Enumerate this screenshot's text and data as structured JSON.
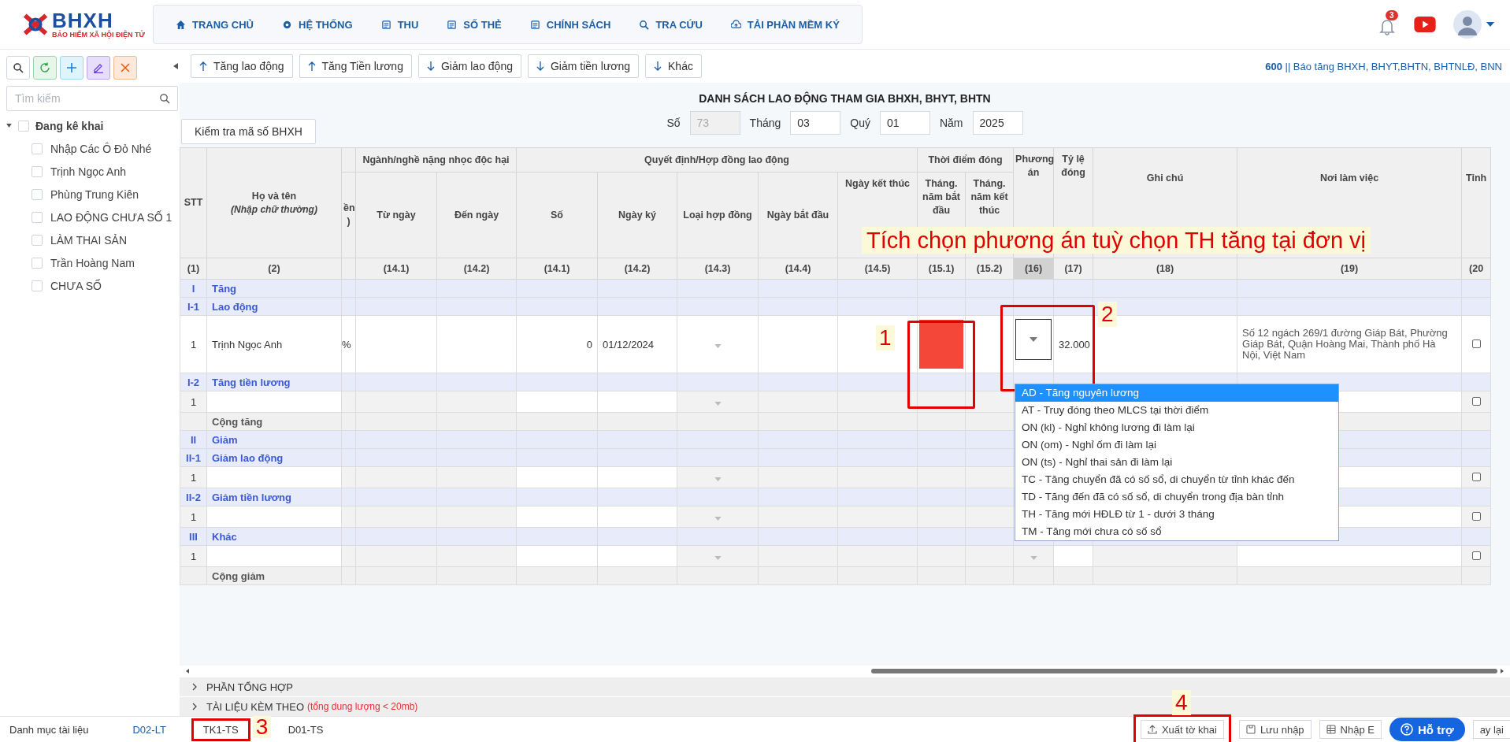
{
  "header": {
    "logo": {
      "title": "BHXH",
      "subtitle": "BẢO HIỂM XÃ HỘI ĐIỆN TỬ"
    },
    "nav": [
      {
        "label": "TRANG CHỦ"
      },
      {
        "label": "HỆ THỐNG"
      },
      {
        "label": "THU"
      },
      {
        "label": "SỐ THẺ"
      },
      {
        "label": "CHÍNH SÁCH"
      },
      {
        "label": "TRA CỨU"
      },
      {
        "label": "TẢI PHẦN MỀM KÝ"
      }
    ],
    "notification_count": "3"
  },
  "sidebar": {
    "search": {
      "placeholder": "Tìm kiếm"
    },
    "tree": {
      "label": "Đang kê khai",
      "expanded": true,
      "checked": false,
      "children": [
        {
          "label": "Nhập Các Ô Đỏ Nhé",
          "checked": false
        },
        {
          "label": "Trịnh Ngọc Anh",
          "checked": false
        },
        {
          "label": "Phùng Trung Kiên",
          "checked": false
        },
        {
          "label": "LAO ĐỘNG CHƯA SỐ 1",
          "checked": false
        },
        {
          "label": "LÀM THAI SẢN",
          "checked": false
        },
        {
          "label": "Trần Hoàng Nam",
          "checked": false
        },
        {
          "label": "CHƯA SỐ",
          "checked": false
        }
      ]
    }
  },
  "toolbar": {
    "buttons": [
      {
        "label": "Tăng lao động"
      },
      {
        "label": "Tăng Tiền lương"
      },
      {
        "label": "Giảm lao động"
      },
      {
        "label": "Giảm tiền lương"
      },
      {
        "label": "Khác"
      }
    ],
    "info": "**600** || Báo tăng BHXH, BHYT,BHTN, BHTNLĐ, BNN"
  },
  "form": {
    "check_button": "Kiểm tra mã số BHXH",
    "title": "DANH SÁCH LAO ĐỘNG THAM GIA BHXH, BHYT, BHTN",
    "fields": [
      {
        "label": "Số",
        "value": "73",
        "disabled": true
      },
      {
        "label": "Tháng",
        "value": "03",
        "disabled": false
      },
      {
        "label": "Quý",
        "value": "01",
        "disabled": false
      },
      {
        "label": "Năm",
        "value": "2025",
        "disabled": false
      }
    ]
  },
  "table": {
    "columns": {
      "stt": "STT",
      "name": "Họ và tên",
      "name_hint": "(Nhập chữ thường)",
      "hidden": "ền )",
      "heavy_group": "Ngành/nghề nặng nhọc độc hại",
      "from": "Từ ngày",
      "to": "Đến ngày",
      "contract_group": "Quyết định/Hợp đồng lao động",
      "number": "Số",
      "sign_date": "Ngày ký",
      "contract_type": "Loại hợp đồng",
      "start": "Ngày bắt đầu",
      "end": "Ngày kết thúc",
      "payment_group": "Thời điểm đóng",
      "pay_from": "Tháng. năm bắt đầu",
      "pay_to": "Tháng. năm kết thúc",
      "plan": "Phương án",
      "rate": "Tỷ lệ đóng",
      "note": "Ghi chú",
      "workplace": "Nơi làm việc",
      "province": "Tỉnh"
    },
    "column_numbers": [
      {
        "label": "(1)",
        "selected": false
      },
      {
        "label": "(2)",
        "selected": false
      },
      {
        "label": "(14.1)",
        "selected": false
      },
      {
        "label": "(14.2)",
        "selected": false
      },
      {
        "label": "(14.1)",
        "selected": false
      },
      {
        "label": "(14.2)",
        "selected": false
      },
      {
        "label": "(14.3)",
        "selected": false
      },
      {
        "label": "(14.4)",
        "selected": false
      },
      {
        "label": "(14.5)",
        "selected": false
      },
      {
        "label": "(15.1)",
        "selected": false
      },
      {
        "label": "(15.2)",
        "selected": false
      },
      {
        "label": "(16)",
        "selected": true
      },
      {
        "label": "(17)",
        "selected": false
      },
      {
        "label": "(18)",
        "selected": false
      },
      {
        "label": "(19)",
        "selected": false
      },
      {
        "label": "(20",
        "selected": false
      }
    ],
    "rows": [
      {
        "kind": "section",
        "code": "I",
        "label": "Tăng"
      },
      {
        "kind": "section",
        "code": "I-1",
        "label": "Lao động"
      },
      {
        "kind": "data",
        "stt": "1",
        "name": "Trịnh Ngọc Anh",
        "hidden": "%",
        "number": "0",
        "sign_date": "01/12/2024",
        "pay_from_invalid": true,
        "plan_expanded": true,
        "rate": "32.000",
        "workplace": "Số 12 ngách 269/1 đường Giáp Bát, Phường Giáp Bát, Quận Hoàng Mai, Thành phố Hà Nội, Việt Nam",
        "checked": false
      },
      {
        "kind": "section",
        "code": "I-2",
        "label": "Tăng tiền lương"
      },
      {
        "kind": "data",
        "stt": "1",
        "pay_from_invalid": false,
        "checked": false
      },
      {
        "kind": "total",
        "label": "Cộng tăng"
      },
      {
        "kind": "section",
        "code": "II",
        "label": "Giảm"
      },
      {
        "kind": "section",
        "code": "II-1",
        "label": "Giảm lao động"
      },
      {
        "kind": "data",
        "stt": "1",
        "pay_from_invalid": false,
        "checked": false
      },
      {
        "kind": "section",
        "code": "II-2",
        "label": "Giảm tiền lương"
      },
      {
        "kind": "data",
        "stt": "1",
        "pay_from_invalid": false,
        "checked": false
      },
      {
        "kind": "section",
        "code": "III",
        "label": "Khác"
      },
      {
        "kind": "data",
        "stt": "1",
        "pay_from_invalid": false,
        "plan_expanded": false,
        "checked": false
      },
      {
        "kind": "total",
        "label": "Cộng giảm"
      }
    ],
    "dropdown": [
      {
        "label": "AD - Tăng nguyên lương",
        "selected": true
      },
      {
        "label": "AT - Truy đóng theo MLCS tại thời điểm",
        "selected": false
      },
      {
        "label": "ON (kl) - Nghỉ không lương đi làm lại",
        "selected": false
      },
      {
        "label": "ON (om) - Nghỉ ốm đi làm lại",
        "selected": false
      },
      {
        "label": "ON (ts) - Nghỉ thai sản đi làm lại",
        "selected": false
      },
      {
        "label": "TC - Tăng chuyển đã có số sổ, di chuyển từ tỉnh khác đến",
        "selected": false
      },
      {
        "label": "TD - Tăng đến đã có số sổ, di chuyển trong địa bàn tỉnh",
        "selected": false
      },
      {
        "label": "TH - Tăng mới HĐLĐ từ 1 - dưới 3 tháng",
        "selected": false
      },
      {
        "label": "TM - Tăng mới chưa có số sổ",
        "selected": false
      }
    ]
  },
  "annotation": {
    "text": "Tích chọn phương án tuỳ chọn TH tăng tại đơn vị",
    "markers": [
      "1",
      "2",
      "3",
      "4"
    ]
  },
  "panels": [
    {
      "label": "PHẦN TỔNG HỢP",
      "expanded": false
    },
    {
      "label": "TÀI LIỆU KÈM THEO",
      "note": "(tổng dung lượng < 20mb)",
      "expanded": false
    }
  ],
  "footer": {
    "label": "Danh mục tài liệu",
    "tabs": [
      {
        "label": "D02-LT",
        "selected": true
      },
      {
        "label": "TK1-TS",
        "selected": false
      },
      {
        "label": "D01-TS",
        "selected": false
      }
    ],
    "buttons": [
      {
        "label": "Xuất tờ khai"
      },
      {
        "label": "Lưu nhập"
      },
      {
        "label": "Nhập E"
      }
    ],
    "cut_button": "ay lại",
    "help": "Hỗ trợ"
  }
}
